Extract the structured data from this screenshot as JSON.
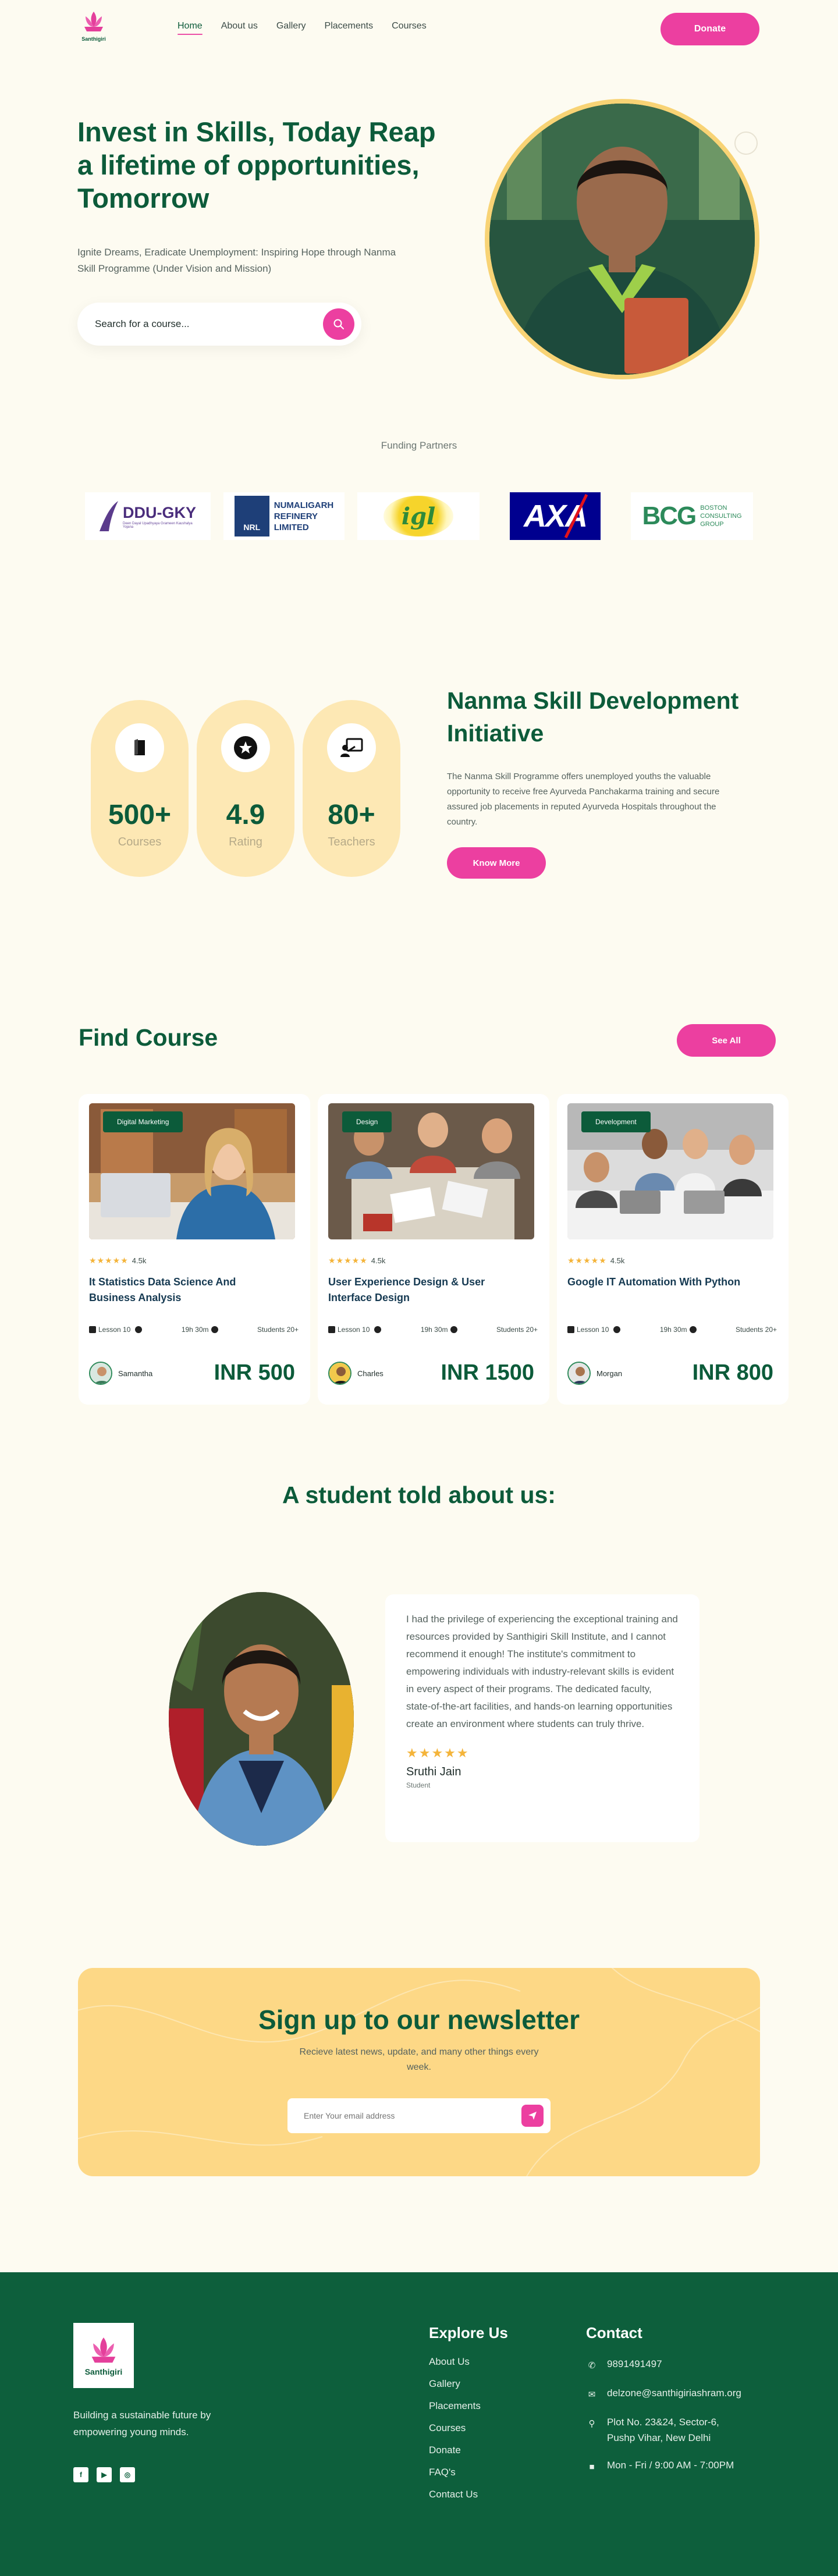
{
  "header": {
    "logo_text": "Santhigiri",
    "nav": [
      {
        "label": "Home",
        "active": true
      },
      {
        "label": "About us"
      },
      {
        "label": "Gallery"
      },
      {
        "label": "Placements"
      },
      {
        "label": "Courses"
      }
    ],
    "donate_label": "Donate"
  },
  "hero": {
    "title": "Invest in Skills, Today Reap a lifetime of opportunities, Tomorrow",
    "subtitle": "Ignite Dreams, Eradicate Unemployment: Inspiring Hope through Nanma Skill Programme (Under Vision and Mission)",
    "search_placeholder": "Search for a course..."
  },
  "funding": {
    "label": "Funding Partners",
    "partners": [
      {
        "name": "DDU-GKY",
        "line1": "DDU-GKY",
        "line2": "Deen Dayal Upadhyaya Grameen Kaushalya Yojana"
      },
      {
        "name": "NRL",
        "line1": "NUMALIGARH",
        "line2": "REFINERY",
        "line3": "LIMITED",
        "badge": "NRL"
      },
      {
        "name": "igl",
        "line1": "igl"
      },
      {
        "name": "AXA",
        "line1": "AXA"
      },
      {
        "name": "BCG",
        "line1": "BCG",
        "line2": "BOSTON",
        "line3": "CONSULTING",
        "line4": "GROUP"
      }
    ]
  },
  "stats": [
    {
      "value": "500+",
      "label": "Courses",
      "icon": "book-icon"
    },
    {
      "value": "4.9",
      "label": "Rating",
      "icon": "star-icon"
    },
    {
      "value": "80+",
      "label": "Teachers",
      "icon": "teacher-icon"
    }
  ],
  "initiative": {
    "title": "Nanma Skill Development Initiative",
    "text": "The Nanma Skill Programme offers unemployed youths the valuable opportunity to receive free Ayurveda Panchakarma training and secure assured job placements in reputed Ayurveda Hospitals throughout the country.",
    "button": "Know More"
  },
  "courses": {
    "title": "Find Course",
    "see_all": "See All",
    "items": [
      {
        "tag": "Digital Marketing",
        "rating": "4.5k",
        "name": "It Statistics Data Science And Business Analysis",
        "lessons": "Lesson 10",
        "duration": "19h 30m",
        "students": "Students 20+",
        "author": "Samantha",
        "price": "INR 500"
      },
      {
        "tag": "Design",
        "rating": "4.5k",
        "name": "User Experience Design & User Interface Design",
        "lessons": "Lesson 10",
        "duration": "19h 30m",
        "students": "Students 20+",
        "author": "Charles",
        "price": "INR 1500"
      },
      {
        "tag": "Development",
        "rating": "4.5k",
        "name": "Google IT Automation With Python",
        "lessons": "Lesson 10",
        "duration": "19h 30m",
        "students": "Students 20+",
        "author": "Morgan",
        "price": "INR 800"
      }
    ]
  },
  "testimonial": {
    "title": "A student told about us:",
    "quote": "I had the privilege of experiencing the exceptional training and resources provided by Santhigiri Skill Institute, and I cannot recommend it enough! The institute's commitment to empowering individuals with industry-relevant skills is evident in every aspect of their programs. The dedicated faculty, state-of-the-art facilities, and hands-on learning opportunities create an environment where students can truly thrive.",
    "stars": "★★★★★",
    "name": "Sruthi Jain",
    "role": "Student"
  },
  "newsletter": {
    "title": "Sign up to our newsletter",
    "subtitle": "Recieve latest news, update, and many other things every week.",
    "placeholder": "Enter Your email address"
  },
  "footer": {
    "logo_text": "Santhigiri",
    "tagline": "Building a sustainable future by empowering young minds.",
    "social": [
      "f",
      "▶",
      "◎"
    ],
    "explore_title": "Explore Us",
    "explore_links": [
      "About Us",
      "Gallery",
      "Placements",
      "Courses",
      "Donate",
      "FAQ's",
      "Contact Us"
    ],
    "contact_title": "Contact",
    "phone": "9891491497",
    "email": "delzone@santhigiriashram.org",
    "address": "Plot No. 23&24, Sector-6, Pushp Vihar, New Delhi",
    "hours": "Mon - Fri / 9:00 AM - 7:00PM"
  },
  "colors": {
    "primary_green": "#0c5b3a",
    "accent_pink": "#ec3fa0",
    "cream": "#fdfbf1",
    "yellow": "#fdd886"
  }
}
